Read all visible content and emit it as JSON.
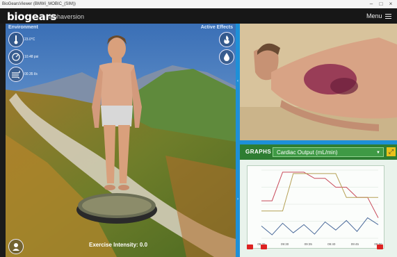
{
  "window": {
    "title": "BioGearsViewer (BMWi_MOBIC_(SIM))",
    "controls": [
      "–",
      "□",
      "×"
    ]
  },
  "app": {
    "brand": "biogears",
    "version": "alphaversion",
    "menu_label": "Menu"
  },
  "environment": {
    "label": "Environment",
    "readouts": [
      {
        "icon": "thermometer-icon",
        "value": "23.0°C"
      },
      {
        "icon": "pressure-gauge-icon",
        "value": "10.48 psi"
      },
      {
        "icon": "wind-icon",
        "value": "00.35 l/s"
      }
    ]
  },
  "active_effects": {
    "label": "Active Effects",
    "icons": [
      "burn-effect-icon",
      "hemorrhage-effect-icon"
    ]
  },
  "scene": {
    "exercise_label": "Exercise Intensity: 0.0"
  },
  "graphs": {
    "label": "GRAPHS",
    "selected": "Cardiac Output (mL/min)",
    "colors": {
      "header": "#2e7d32",
      "accent": "#e9c21b"
    }
  },
  "chart_data": {
    "type": "line",
    "x": [
      "09:25",
      "09:30",
      "09:35",
      "09:40",
      "09:45",
      "09:50"
    ],
    "series": [
      {
        "color": "#c84a5a",
        "values": [
          55,
          55,
          97,
          97,
          97,
          88,
          88,
          75,
          75,
          60,
          60,
          30
        ]
      },
      {
        "color": "#b5a055",
        "values": [
          40,
          40,
          40,
          95,
          95,
          95,
          95,
          95,
          60,
          60,
          60,
          60
        ]
      },
      {
        "color": "#4a6a9a",
        "values": [
          18,
          5,
          22,
          8,
          20,
          6,
          24,
          12,
          26,
          10,
          30,
          20
        ]
      }
    ],
    "ylim": [
      0,
      100
    ]
  }
}
